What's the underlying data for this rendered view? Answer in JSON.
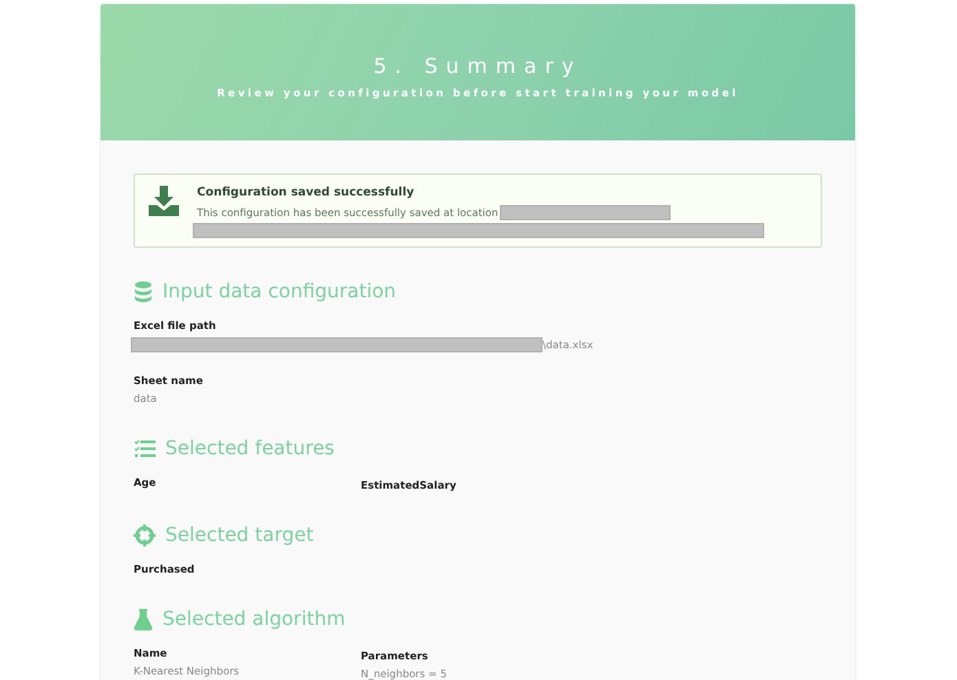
{
  "header": {
    "title": "5. Summary",
    "subtitle": "Review your configuration before start training your model"
  },
  "notice": {
    "title": "Configuration saved successfully",
    "message": "This configuration has been successfully saved at location",
    "redacted": true
  },
  "sections": [
    {
      "title": "Input data configuration",
      "kind": "stack",
      "items": [
        {
          "label": "Excel file path",
          "value": "\\data.xlsx",
          "redacted": true
        },
        {
          "label": "Sheet name",
          "value": "data",
          "redacted": false
        }
      ]
    },
    {
      "title": "Selected features",
      "kind": "columns",
      "items": [
        {
          "label": "Age"
        },
        {
          "label": "EstimatedSalary"
        }
      ]
    },
    {
      "title": "Selected target",
      "kind": "stack",
      "items": [
        {
          "label": "Purchased"
        }
      ]
    },
    {
      "title": "Selected algorithm",
      "kind": "columns",
      "items": [
        {
          "label": "Name",
          "value": "K-Nearest Neighbors"
        },
        {
          "label": "Parameters",
          "value": "N_neighbors = 5"
        }
      ]
    }
  ]
}
